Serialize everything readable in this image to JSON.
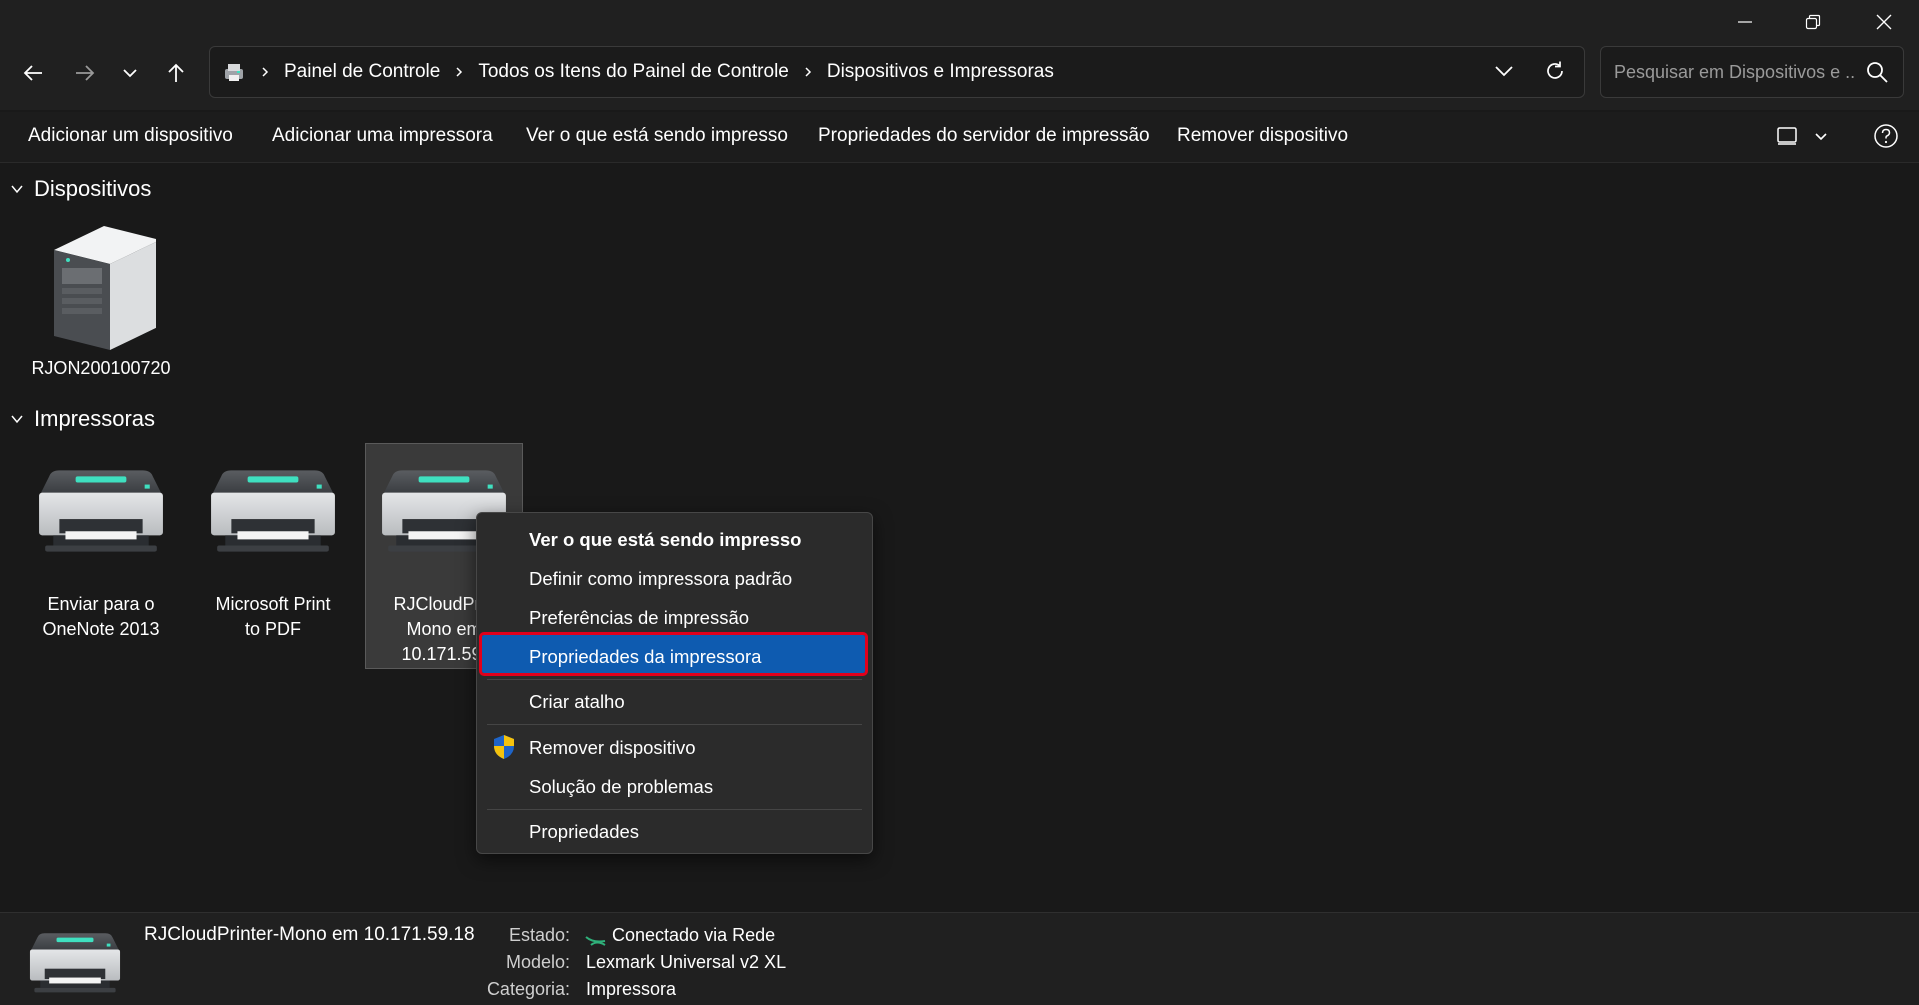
{
  "window": {
    "controls": [
      "minimize",
      "restore",
      "close"
    ]
  },
  "address_bar": {
    "breadcrumbs": [
      "Painel de Controle",
      "Todos os Itens do Painel de Controle",
      "Dispositivos e Impressoras"
    ]
  },
  "search": {
    "placeholder": "Pesquisar em Dispositivos e ..."
  },
  "commands": {
    "add_device": "Adicionar um dispositivo",
    "add_printer": "Adicionar uma impressora",
    "see_printing": "Ver o que está sendo impresso",
    "server_props": "Propriedades do servidor de impressão",
    "remove_device": "Remover dispositivo"
  },
  "groups": {
    "devices": {
      "title": "Dispositivos",
      "items": [
        {
          "label": "RJON200100720",
          "icon": "server-icon"
        }
      ]
    },
    "printers": {
      "title": "Impressoras",
      "items": [
        {
          "line1": "Enviar para o",
          "line2": "OneNote 2013",
          "icon": "printer-icon"
        },
        {
          "line1": "Microsoft Print",
          "line2": "to PDF",
          "icon": "printer-icon"
        },
        {
          "line1": "RJCloudPrin",
          "line2": "Mono em",
          "line3": "10.171.59.",
          "icon": "printer-icon"
        }
      ]
    }
  },
  "context_menu": {
    "see_printing": "Ver o que está sendo impresso",
    "set_default": "Definir como impressora padrão",
    "preferences": "Preferências de impressão",
    "printer_properties": "Propriedades da impressora",
    "create_shortcut": "Criar atalho",
    "remove_device": "Remover dispositivo",
    "troubleshoot": "Solução de problemas",
    "properties": "Propriedades",
    "highlighted": "Propriedades da impressora"
  },
  "details": {
    "name": "RJCloudPrinter-Mono em 10.171.59.18",
    "state_label": "Estado:",
    "state_value": "Conectado via Rede",
    "model_label": "Modelo:",
    "model_value": "Lexmark Universal v2 XL",
    "category_label": "Categoria:",
    "category_value": "Impressora"
  },
  "colors": {
    "background": "#191919",
    "toolbar": "#202020",
    "menu_highlight": "#0e5bb0",
    "annotation_box": "#e0001b",
    "printer_light": "#3fe0c0"
  }
}
